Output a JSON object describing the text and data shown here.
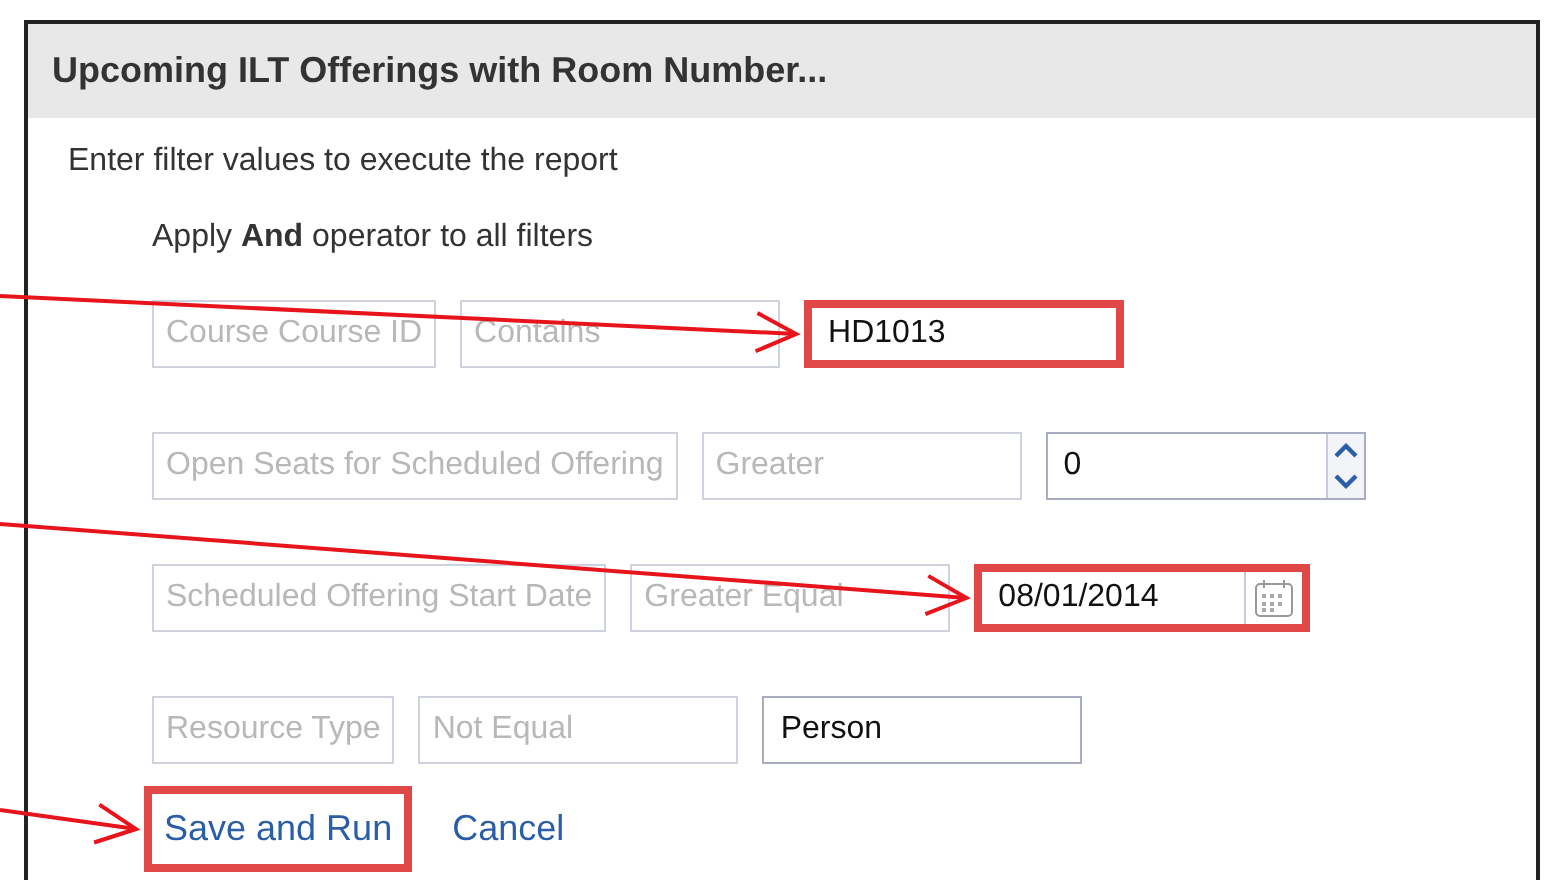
{
  "panel": {
    "title": "Upcoming ILT Offerings with Room Number...",
    "instruction": "Enter filter values to execute the report",
    "operator_note": "Apply **And** operator to all filters",
    "filters": [
      {
        "field": "Course Course ID",
        "operator": "Contains",
        "kind": "text",
        "value": "HD1013",
        "highlighted": true
      },
      {
        "field": "Open Seats for Scheduled Offering",
        "operator": "Greater",
        "kind": "spinner",
        "value": "0",
        "highlighted": false
      },
      {
        "field": "Scheduled Offering Start Date",
        "operator": "Greater Equal",
        "kind": "date",
        "value": "08/01/2014",
        "highlighted": true
      },
      {
        "field": "Resource Type",
        "operator": "Not Equal",
        "kind": "text",
        "value": "Person",
        "highlighted": false
      }
    ],
    "actions": [
      {
        "label": "Save and Run",
        "highlighted": true
      },
      {
        "label": "Cancel",
        "highlighted": false
      }
    ]
  }
}
